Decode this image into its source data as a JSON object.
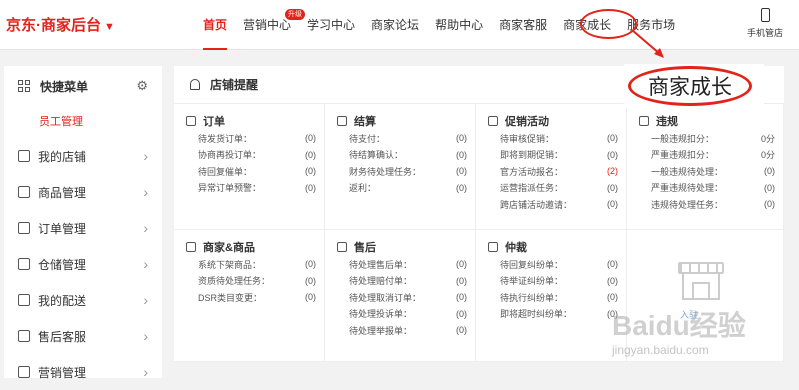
{
  "logo": {
    "text": "京东·商家后台",
    "caret": "▼"
  },
  "nav": {
    "items": [
      {
        "label": "首页",
        "active": true
      },
      {
        "label": "营销中心",
        "badge": "升级"
      },
      {
        "label": "学习中心"
      },
      {
        "label": "商家论坛"
      },
      {
        "label": "帮助中心"
      },
      {
        "label": "商家客服"
      },
      {
        "label": "商家成长"
      },
      {
        "label": "服务市场"
      }
    ],
    "mobile": "手机管店"
  },
  "zoom_callout": "商家成长",
  "sidebar": {
    "header": "快捷菜单",
    "sub": "员工管理",
    "items": [
      {
        "label": "我的店铺"
      },
      {
        "label": "商品管理"
      },
      {
        "label": "订单管理"
      },
      {
        "label": "仓储管理"
      },
      {
        "label": "我的配送"
      },
      {
        "label": "售后客服"
      },
      {
        "label": "营销管理"
      }
    ]
  },
  "main": {
    "title": "店铺提醒",
    "sections": [
      {
        "title": "订单",
        "rows": [
          [
            "待发货订单：",
            "(0)"
          ],
          [
            "协商再投订单：",
            "(0)"
          ],
          [
            "待回复催单：",
            "(0)"
          ],
          [
            "异常订单预警：",
            "(0)"
          ]
        ]
      },
      {
        "title": "结算",
        "rows": [
          [
            "待支付：",
            "(0)"
          ],
          [
            "待结算确认：",
            "(0)"
          ],
          [
            "财务待处理任务：",
            "(0)"
          ],
          [
            "返利：",
            "(0)"
          ]
        ]
      },
      {
        "title": "促销活动",
        "rows": [
          [
            "待审核促销：",
            "(0)"
          ],
          [
            "即将到期促销：",
            "(0)"
          ],
          [
            "官方活动报名：",
            "(2)"
          ],
          [
            "运营指派任务：",
            "(0)"
          ],
          [
            "跨店铺活动邀请：",
            "(0)"
          ]
        ]
      },
      {
        "title": "违规",
        "rows": [
          [
            "一般违规扣分：",
            "0分"
          ],
          [
            "严重违规扣分：",
            "0分"
          ],
          [
            "一般违规待处理：",
            "(0)"
          ],
          [
            "严重违规待处理：",
            "(0)"
          ],
          [
            "违规待处理任务：",
            "(0)"
          ]
        ]
      },
      {
        "title": "商家&商品",
        "rows": [
          [
            "系统下架商品：",
            "(0)"
          ],
          [
            "资质待处理任务：",
            "(0)"
          ],
          [
            "DSR类目变更：",
            "(0)"
          ]
        ]
      },
      {
        "title": "售后",
        "rows": [
          [
            "待处理售后单：",
            "(0)"
          ],
          [
            "待处理赔付单：",
            "(0)"
          ],
          [
            "待处理取消订单：",
            "(0)"
          ],
          [
            "待处理投诉单：",
            "(0)"
          ],
          [
            "待处理举报单：",
            "(0)"
          ]
        ]
      },
      {
        "title": "仲裁",
        "rows": [
          [
            "待回复纠纷单：",
            "(0)"
          ],
          [
            "待举证纠纷单：",
            "(0)"
          ],
          [
            "待执行纠纷单：",
            "(0)"
          ],
          [
            "即将超时纠纷单：",
            "(0)"
          ]
        ]
      }
    ],
    "store_link": "入驻"
  },
  "watermark": {
    "main": "Baidu经验",
    "sub": "jingyan.baidu.com"
  },
  "colors": {
    "accent": "#e2231a"
  }
}
